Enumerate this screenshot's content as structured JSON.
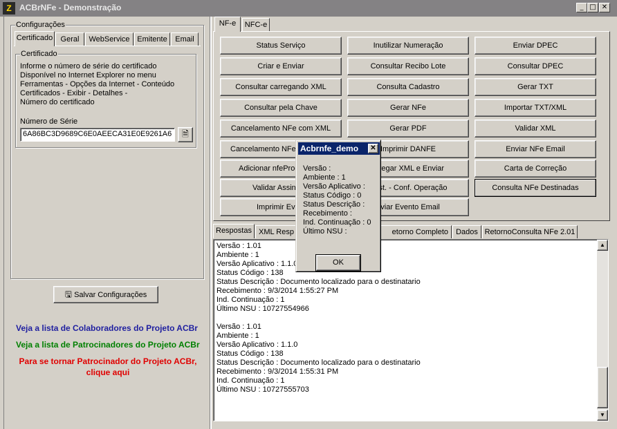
{
  "window": {
    "title": "ACBrNFe - Demonstração",
    "icon_char": "Z"
  },
  "config": {
    "group_label": "Configurações",
    "tabs": [
      "Certificado",
      "Geral",
      "WebService",
      "Emitente",
      "Email"
    ],
    "cert_group_label": "Certificado",
    "cert_info": [
      "Informe o número de série do certificado",
      "Disponível no Internet Explorer no menu",
      "Ferramentas - Opções da Internet - Conteúdo",
      "Certificados - Exibir - Detalhes -",
      "Número do certificado"
    ],
    "serial_label": "Número de Série",
    "serial_value": "6A86BC3D9689C6E0AEECA31E0E9261A6",
    "save_label": "Salvar Configurações"
  },
  "links": {
    "colaboradores": "Veja a lista de Colaboradores do Projeto ACBr",
    "patrocinadores": "Veja a lista de Patrocinadores do Projeto ACBr",
    "patrocinador_line1": "Para se tornar Patrocinador do Projeto ACBr,",
    "patrocinador_line2": "clique aqui"
  },
  "nfe_tabs": [
    "NF-e",
    "NFC-e"
  ],
  "buttons": {
    "status": "Status Serviço",
    "inutilizar": "Inutilizar Numeração",
    "enviar_dpec": "Enviar DPEC",
    "criar_enviar": "Criar e Enviar",
    "consultar_recibo": "Consultar Recibo Lote",
    "consultar_dpec": "Consultar DPEC",
    "consultar_xml": "Consultar carregando XML",
    "consulta_cadastro": "Consulta Cadastro",
    "gerar_txt": "Gerar TXT",
    "consultar_chave": "Consultar pela Chave",
    "gerar_nfe": "Gerar NFe",
    "importar_txt": "Importar TXT/XML",
    "cancelamento_xml": "Cancelamento NFe com XML",
    "gerar_pdf": "Gerar PDF",
    "validar_xml": "Validar XML",
    "cancelamento_nfe": "Cancelamento NFe",
    "imprimir_danfe": "Imprimir DANFE",
    "enviar_email": "Enviar NFe Email",
    "adicionar_prot": "Adicionar nfeProc",
    "carregar_xml_enviar": "arregar XML e Enviar",
    "carta_correcao": "Carta de Correção",
    "validar_assin": "Validar Assin",
    "manif_dest": "Dest. - Conf. Operação",
    "consulta_destinadas": "Consulta NFe Destinadas",
    "imprimir_evento": "Imprimir Eve",
    "enviar_evento_email": "nviar Evento Email"
  },
  "response_tabs": [
    "Respostas",
    "XML Resp",
    "etorno Completo WS",
    "Dados",
    "RetornoConsulta NFe 2.01"
  ],
  "memo_lines": [
    "Versão : 1.01",
    "Ambiente : 1",
    "Versão Aplicativo : 1.1.0",
    "Status Código : 138",
    "Status Descrição : Documento localizado para o destinatario",
    "Recebimento : 9/3/2014 1:55:27 PM",
    "Ind. Continuação : 1",
    "Último NSU : 10727554966",
    "",
    "Versão : 1.01",
    "Ambiente : 1",
    "Versão Aplicativo : 1.1.0",
    "Status Código : 138",
    "Status Descrição : Documento localizado para o destinatario",
    "Recebimento : 9/3/2014 1:55:31 PM",
    "Ind. Continuação : 1",
    "Último NSU : 10727555703"
  ],
  "dialog": {
    "title": "Acbrnfe_demo",
    "lines": [
      "Versão :",
      "Ambiente : 1",
      "Versão Aplicativo :",
      "Status Código : 0",
      "Status Descrição :",
      "Recebimento :",
      "Ind. Continuação : 0",
      "Último NSU :"
    ],
    "ok_label": "OK"
  }
}
